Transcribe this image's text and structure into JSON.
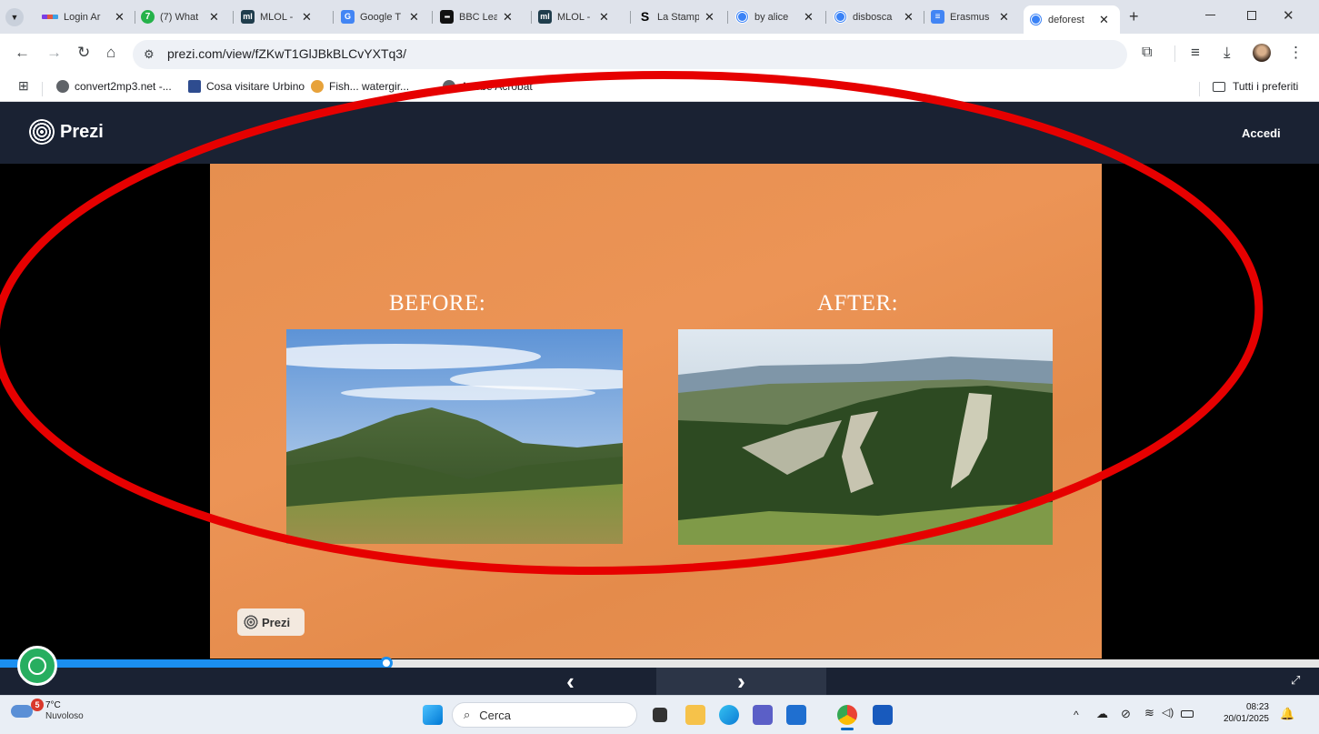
{
  "browser": {
    "tabs": [
      {
        "label": "Login Ar",
        "icon": "login-favicon-icon"
      },
      {
        "label": "(7) What",
        "icon": "whatsapp-favicon-icon"
      },
      {
        "label": "MLOL -",
        "icon": "mlol-favicon-icon"
      },
      {
        "label": "Google T",
        "icon": "google-translate-favicon-icon"
      },
      {
        "label": "BBC Lea",
        "icon": "bbc-favicon-icon"
      },
      {
        "label": "MLOL -",
        "icon": "mlol-favicon-icon"
      },
      {
        "label": "La Stamp",
        "icon": "lastampa-favicon-icon"
      },
      {
        "label": "by alice",
        "icon": "prezi-favicon-icon"
      },
      {
        "label": "disbosca",
        "icon": "prezi-favicon-icon"
      },
      {
        "label": "Erasmus",
        "icon": "docs-favicon-icon"
      },
      {
        "label": "deforest",
        "icon": "prezi-favicon-icon",
        "active": true
      }
    ],
    "new_tab": "+",
    "url": "prezi.com/view/fZKwT1GlJBkBLCvYXTq3/",
    "bookmarks": [
      {
        "label": "convert2mp3.net -..."
      },
      {
        "label": "Cosa visitare Urbino"
      },
      {
        "label": "Fish... watergir..."
      },
      {
        "label": "Adobe Acrobat"
      }
    ],
    "all_bookmarks": "Tutti i preferiti"
  },
  "prezi": {
    "logo_text": "Prezi",
    "login": "Accedi",
    "slide": {
      "before_title": "BEFORE:",
      "after_title": "AFTER:",
      "watermark": "Prezi"
    },
    "progress": 0.293,
    "prev": "‹",
    "next": "›"
  },
  "taskbar": {
    "weather_temp": "7°C",
    "weather_desc": "Nuvoloso",
    "weather_badge": "5",
    "search_placeholder": "Cerca",
    "time": "08:23",
    "date": "20/01/2025"
  },
  "colors": {
    "prezi_dark": "#1a2233",
    "slide_orange": "#e98f50",
    "progress_blue": "#1b8ff0",
    "annotation_red": "#e60000"
  }
}
